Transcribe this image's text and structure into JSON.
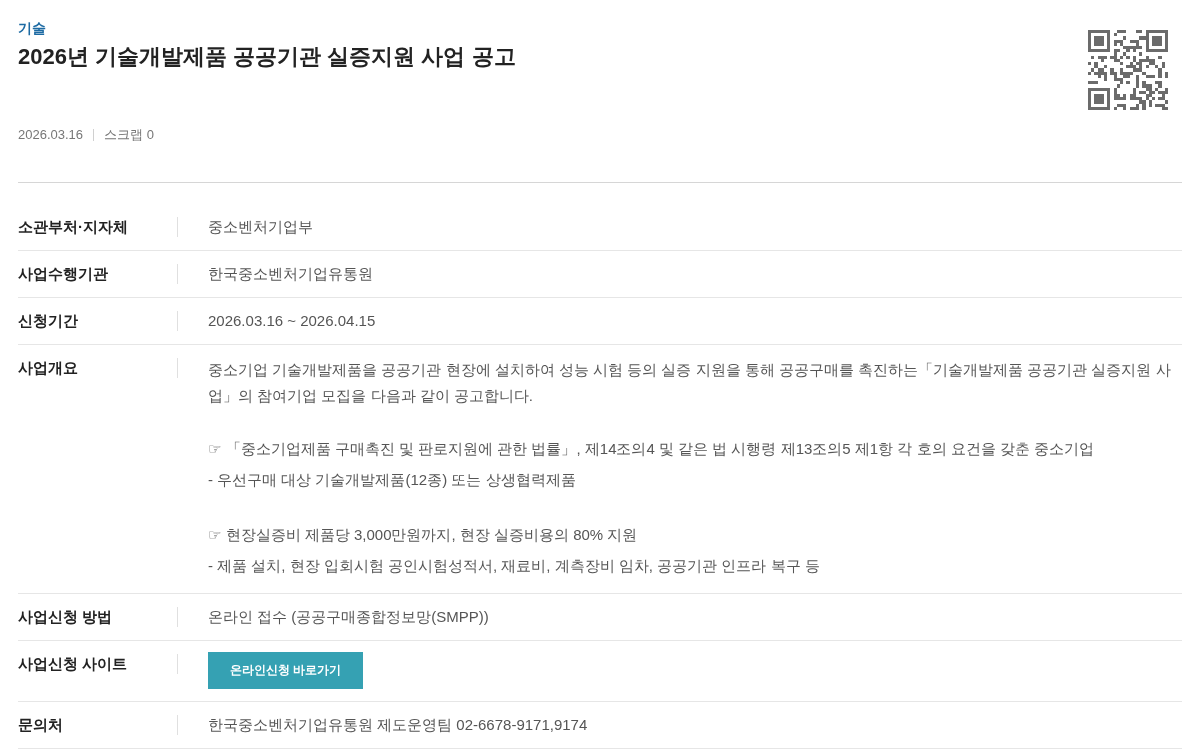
{
  "category": "기술",
  "title": "2026년 기술개발제품 공공기관 실증지원 사업 공고",
  "meta": {
    "date": "2026.03.16",
    "scrap": "스크랩 0"
  },
  "details": [
    {
      "kind": "text",
      "label": "소관부처·지자체",
      "value": "중소벤처기업부"
    },
    {
      "kind": "text",
      "label": "사업수행기관",
      "value": "한국중소벤처기업유통원"
    },
    {
      "kind": "text",
      "label": "신청기간",
      "value": "2026.03.16 ~ 2026.04.15"
    },
    {
      "kind": "overview",
      "label": "사업개요",
      "intro": "중소기업 기술개발제품을 공공기관 현장에 설치하여 성능 시험 등의 실증 지원을 통해 공공구매를 촉진하는「기술개발제품 공공기관 실증지원 사업」의 참여기업 모집을 다음과 같이 공고합니다.",
      "blocks": [
        [
          "☞ 「중소기업제품 구매촉진 및 판로지원에 관한 법률」, 제14조의4 및 같은 법 시행령 제13조의5 제1항 각 호의 요건을 갖춘 중소기업",
          "- 우선구매 대상 기술개발제품(12종) 또는 상생협력제품"
        ],
        [
          "☞ 현장실증비 제품당 3,000만원까지, 현장 실증비용의 80% 지원",
          "- 제품 설치, 현장 입회시험 공인시험성적서, 재료비, 계측장비 임차, 공공기관 인프라 복구 등"
        ]
      ]
    },
    {
      "kind": "text",
      "label": "사업신청 방법",
      "value": "온라인 접수 (공공구매종합정보망(SMPP))"
    },
    {
      "kind": "button",
      "label": "사업신청 사이트",
      "button": "온라인신청 바로가기"
    },
    {
      "kind": "text",
      "label": "문의처",
      "value": "한국중소벤처기업유통원 제도운영팀 02-6678-9171,9174"
    }
  ]
}
